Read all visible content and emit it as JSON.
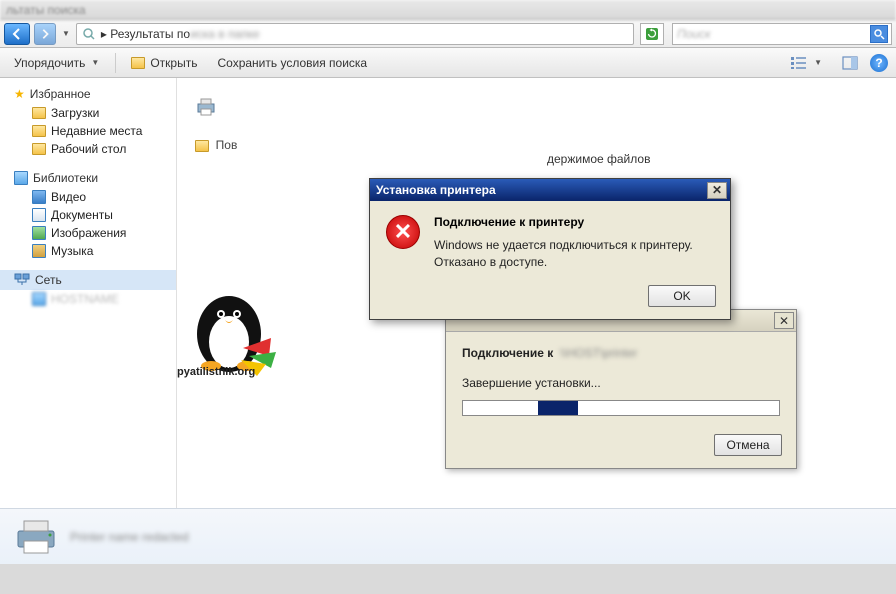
{
  "window_title": "льтаты поиска",
  "breadcrumb": {
    "prefix": "▸",
    "text": "Результаты по"
  },
  "toolbar": {
    "organize": "Упорядочить",
    "open": "Открыть",
    "save_search": "Сохранить условия поиска"
  },
  "sidebar": {
    "favorites": {
      "label": "Избранное",
      "items": [
        "Загрузки",
        "Недавние места",
        "Рабочий стол"
      ]
    },
    "libraries": {
      "label": "Библиотеки",
      "items": [
        "Видео",
        "Документы",
        "Изображения",
        "Музыка"
      ]
    },
    "network": {
      "label": "Сеть"
    }
  },
  "content": {
    "partial_row": "Пов",
    "message_fragment": "держимое файлов",
    "logo_text": "pyatilistnik.org"
  },
  "error_dialog": {
    "title": "Установка принтера",
    "heading": "Подключение к принтеру",
    "line1": "Windows не удается подключиться к принтеру.",
    "line2": "Отказано в доступе.",
    "ok": "OK"
  },
  "progress_dialog": {
    "connect_label": "Подключение к",
    "status": "Завершение установки...",
    "cancel": "Отмена"
  }
}
